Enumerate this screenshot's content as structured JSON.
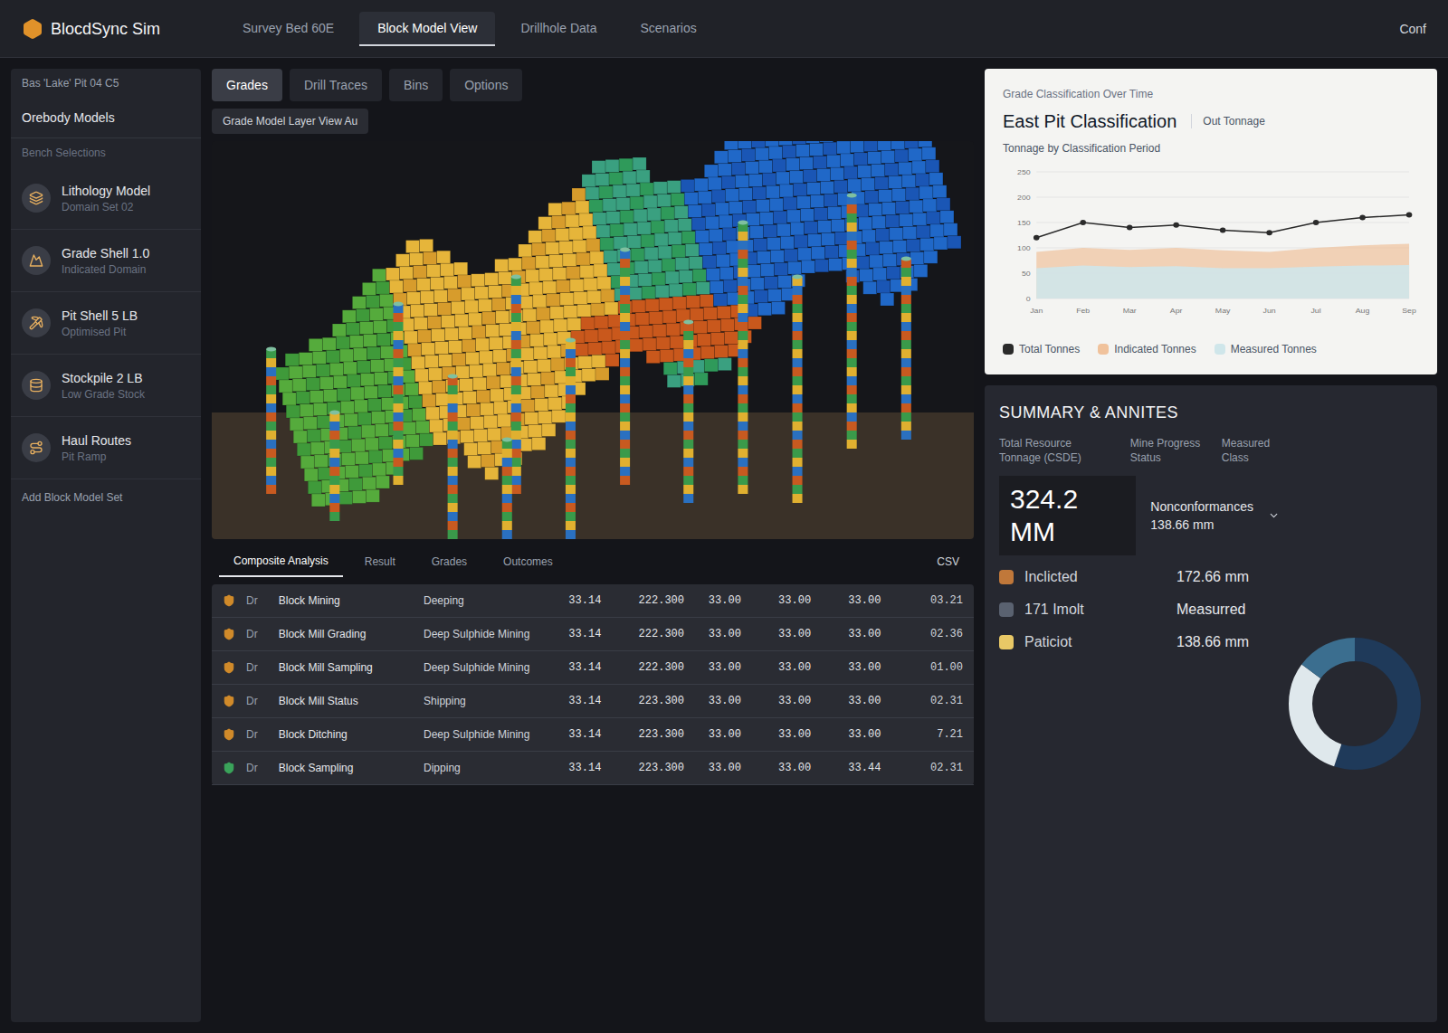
{
  "app": {
    "title": "BlocdSync Sim",
    "subtitle": "Bas 'Lake' Pit 04 C5",
    "corner": "Conf"
  },
  "tabs": [
    {
      "label": "Survey Bed 60E",
      "selected": false
    },
    {
      "label": "Block Model View",
      "selected": true
    },
    {
      "label": "Drillhole Data",
      "selected": false
    },
    {
      "label": "Scenarios",
      "selected": false
    }
  ],
  "view_tabs": [
    {
      "label": "Grades",
      "selected": true
    },
    {
      "label": "Drill Traces",
      "selected": false
    },
    {
      "label": "Bins",
      "selected": false
    },
    {
      "label": "Options",
      "selected": false
    }
  ],
  "viewport": {
    "label": "Grade Model Layer View Au"
  },
  "sidebar": {
    "title": "Orebody Models",
    "subtitle": "Bench Selections",
    "items": [
      {
        "title": "Lithology Model",
        "subtitle": "Domain Set 02"
      },
      {
        "title": "Grade Shell 1.0",
        "subtitle": "Indicated Domain"
      },
      {
        "title": "Pit Shell 5 LB",
        "subtitle": "Optimised Pit"
      },
      {
        "title": "Stockpile 2 LB",
        "subtitle": "Low Grade Stock"
      },
      {
        "title": "Haul Routes",
        "subtitle": "Pit Ramp"
      }
    ],
    "footer": "Add Block Model Set"
  },
  "chart_card": {
    "caption": "Grade Classification Over Time",
    "title": "East Pit Classification",
    "badge": "Out Tonnage",
    "chart_title": "Tonnage by Classification Period",
    "y_ticks": [
      "0",
      "50",
      "100",
      "150",
      "200",
      "250"
    ],
    "x_ticks": [
      "Jan",
      "Feb",
      "Mar",
      "Apr",
      "May",
      "Jun",
      "Jul",
      "Aug",
      "Sep"
    ],
    "series": [
      {
        "name": "Total Tonnes",
        "values": [
          120,
          150,
          140,
          145,
          135,
          130,
          150,
          160,
          165
        ],
        "color": "#2a2a2a"
      },
      {
        "name": "Indicated Tonnes",
        "values": [
          92,
          100,
          96,
          100,
          95,
          92,
          100,
          105,
          108
        ],
        "color": "#f0c29c"
      },
      {
        "name": "Measured Tonnes",
        "values": [
          60,
          65,
          62,
          64,
          60,
          60,
          63,
          65,
          66
        ],
        "color": "#cfe6ea"
      }
    ]
  },
  "table": {
    "tabs": [
      {
        "label": "Composite Analysis",
        "selected": true
      },
      {
        "label": "Result",
        "selected": false
      },
      {
        "label": "Grades",
        "selected": false
      },
      {
        "label": "Outcomes",
        "selected": false
      }
    ],
    "action": "CSV",
    "rows": [
      {
        "id": "Dr",
        "name": "Block Mining",
        "type": "Deeping",
        "values": [
          "33.14",
          "222.300",
          "33.00",
          "33.00",
          "33.00"
        ],
        "last": "03.21",
        "color": "#d08a2a"
      },
      {
        "id": "Dr",
        "name": "Block Mill Grading",
        "type": "Deep Sulphide Mining",
        "values": [
          "33.14",
          "222.300",
          "33.00",
          "33.00",
          "33.00"
        ],
        "last": "02.36",
        "color": "#d08a2a"
      },
      {
        "id": "Dr",
        "name": "Block Mill Sampling",
        "type": "Deep Sulphide Mining",
        "values": [
          "33.14",
          "222.300",
          "33.00",
          "33.00",
          "33.00"
        ],
        "last": "01.00",
        "color": "#d08a2a"
      },
      {
        "id": "Dr",
        "name": "Block Mill Status",
        "type": "Shipping",
        "values": [
          "33.14",
          "223.300",
          "33.00",
          "33.00",
          "33.00"
        ],
        "last": "02.31",
        "color": "#d08a2a"
      },
      {
        "id": "Dr",
        "name": "Block Ditching",
        "type": "Deep Sulphide Mining",
        "values": [
          "33.14",
          "223.300",
          "33.00",
          "33.00",
          "33.00"
        ],
        "last": "7.21",
        "color": "#d08a2a"
      },
      {
        "id": "Dr",
        "name": "Block Sampling",
        "type": "Dipping",
        "values": [
          "33.14",
          "223.300",
          "33.00",
          "33.00",
          "33.44"
        ],
        "last": "02.31",
        "color": "#3aa35a"
      }
    ]
  },
  "summary": {
    "title": "SUMMARY & ANNITES",
    "subtitle": "Total Resource Tonnage (CSDE)",
    "columns": [
      "Mine Progress Status",
      "Measured Class"
    ],
    "total": "324.2 MM",
    "right_title": "Nonconformances",
    "right_value": "138.66 mm",
    "items": [
      {
        "label": "Inclicted",
        "value": "172.66 mm",
        "color": "#c0783a"
      },
      {
        "label": "171 Imolt",
        "value": "Measurred",
        "color": "#5a6270"
      },
      {
        "label": "Paticiot",
        "value": "138.66 mm",
        "color": "#e8c866"
      }
    ],
    "pie": [
      {
        "value": 55,
        "color": "#1f3a5a"
      },
      {
        "value": 30,
        "color": "#dfe8ec"
      },
      {
        "value": 15,
        "color": "#3b6e8f"
      }
    ]
  }
}
